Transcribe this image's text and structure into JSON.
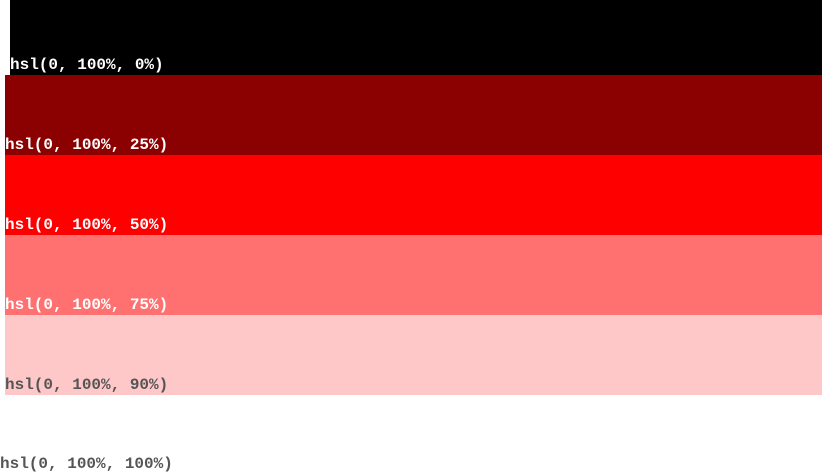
{
  "swatches": [
    {
      "label": "hsl(0, 100%, 0%)",
      "color": "#000000"
    },
    {
      "label": "hsl(0, 100%, 25%)",
      "color": "#8b0000"
    },
    {
      "label": "hsl(0, 100%, 50%)",
      "color": "#ff0000"
    },
    {
      "label": "hsl(0, 100%, 75%)",
      "color": "#ff7070"
    },
    {
      "label": "hsl(0, 100%, 90%)",
      "color": "#ffc8c8"
    },
    {
      "label": "hsl(0, 100%, 100%)",
      "color": "#ffffff"
    }
  ],
  "label_colors": {
    "light": "#ffffff",
    "dark": "#555555"
  }
}
